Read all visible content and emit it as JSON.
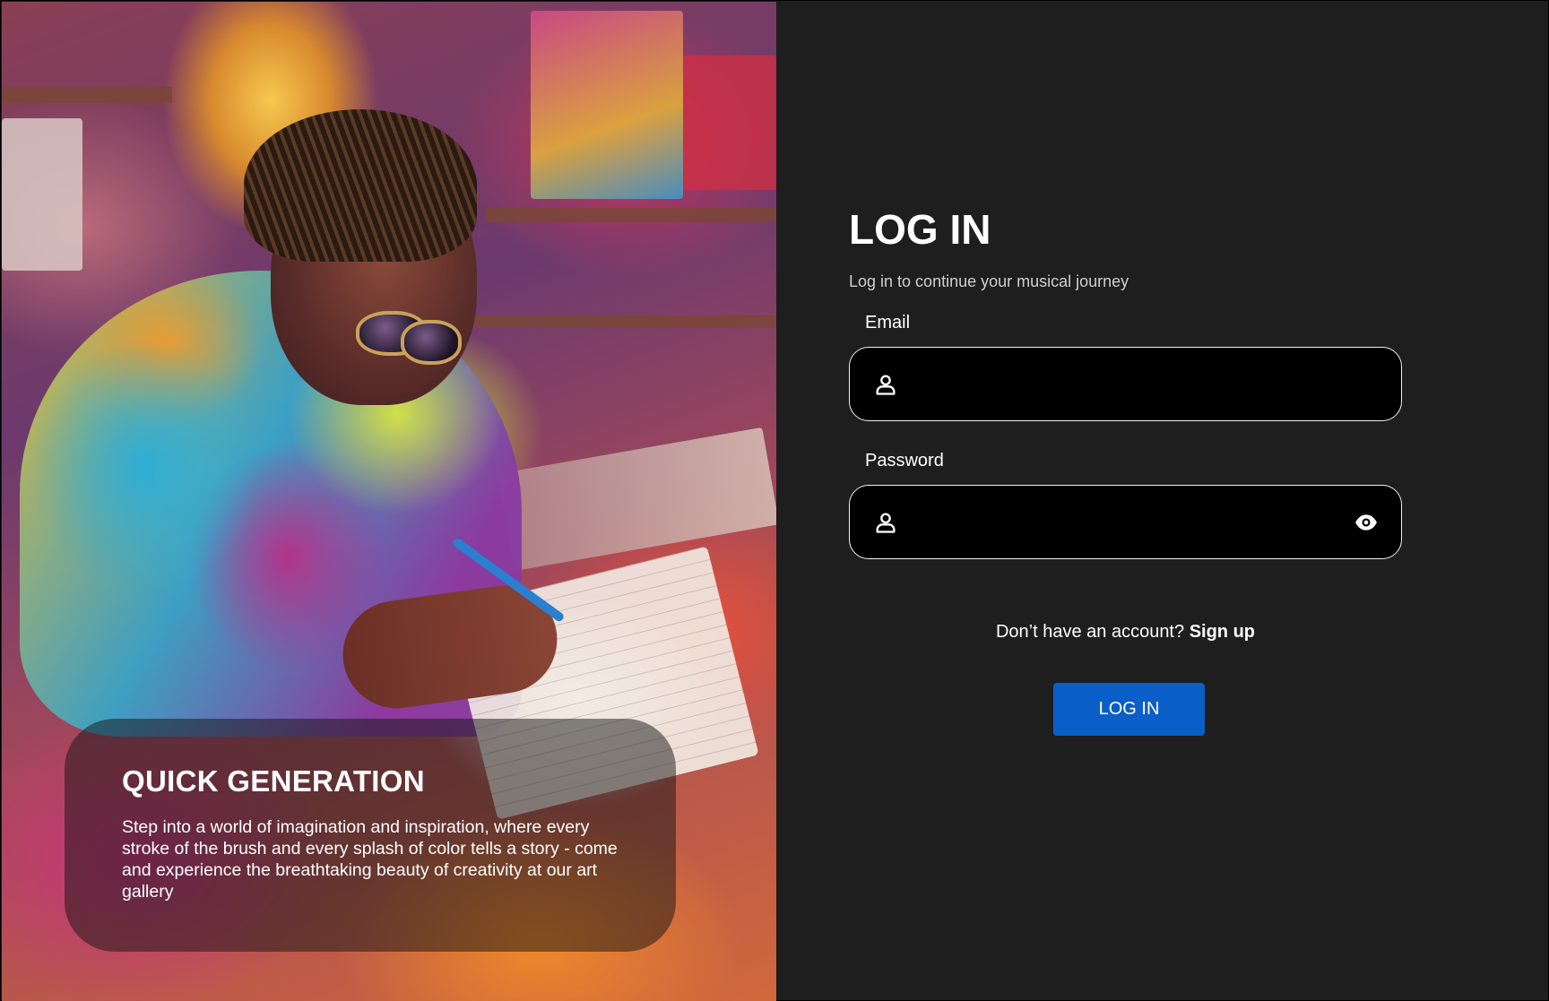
{
  "hero": {
    "title": "QUICK GENERATION",
    "description": "Step into a world of imagination and inspiration, where every stroke of the brush and every splash of color tells a story - come and experience the breathtaking beauty of creativity at our art gallery"
  },
  "login": {
    "title": "LOG IN",
    "subtitle": "Log in to continue your musical journey",
    "email": {
      "label": "Email",
      "value": "",
      "icon": "user-icon"
    },
    "password": {
      "label": "Password",
      "value": "",
      "icon": "user-icon",
      "toggle_icon": "eye-icon"
    },
    "signup_prompt": "Don’t have an account?",
    "signup_link": "Sign up",
    "submit_label": "LOG IN"
  },
  "colors": {
    "background": "#1e1e1e",
    "input_background": "#000000",
    "input_border": "#f0f0f0",
    "primary_button": "#0a5ec8",
    "text": "#ffffff"
  }
}
